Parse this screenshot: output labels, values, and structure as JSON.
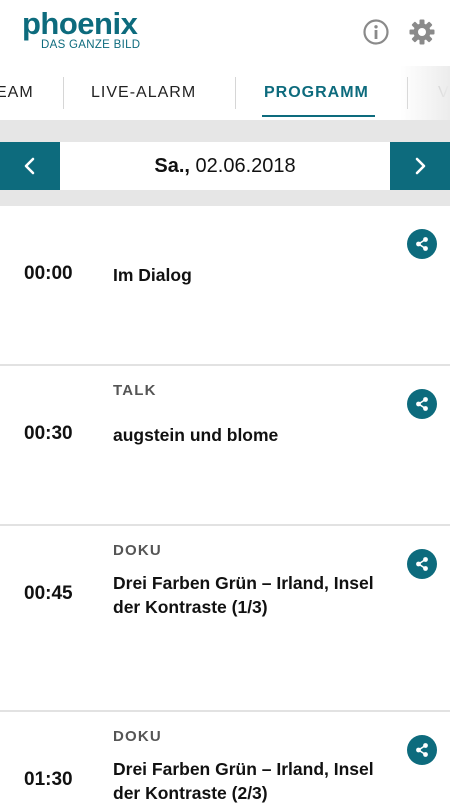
{
  "header": {
    "logo_main": "phoenix",
    "logo_sub": "DAS GANZE BILD",
    "icons": [
      "info-icon",
      "gear-icon"
    ]
  },
  "tabs": [
    {
      "label": "EAM",
      "active": false
    },
    {
      "label": "LIVE-ALARM",
      "active": false
    },
    {
      "label": "PROGRAMM",
      "active": true
    },
    {
      "label": "V",
      "active": false
    }
  ],
  "datebar": {
    "day": "Sa.,",
    "date": "02.06.2018"
  },
  "programs": [
    {
      "time": "00:00",
      "genre": "",
      "title": "Im Dialog"
    },
    {
      "time": "00:30",
      "genre": "TALK",
      "title": "augstein und blome"
    },
    {
      "time": "00:45",
      "genre": "DOKU",
      "title": "Drei Farben Grün – Irland, Insel der Kontraste (1/3)"
    },
    {
      "time": "01:30",
      "genre": "DOKU",
      "title": "Drei Farben Grün – Irland, Insel der Kontraste (2/3)"
    }
  ],
  "colors": {
    "accent": "#0d6b7d",
    "background": "#ffffff",
    "separator": "#e6e6e6"
  }
}
